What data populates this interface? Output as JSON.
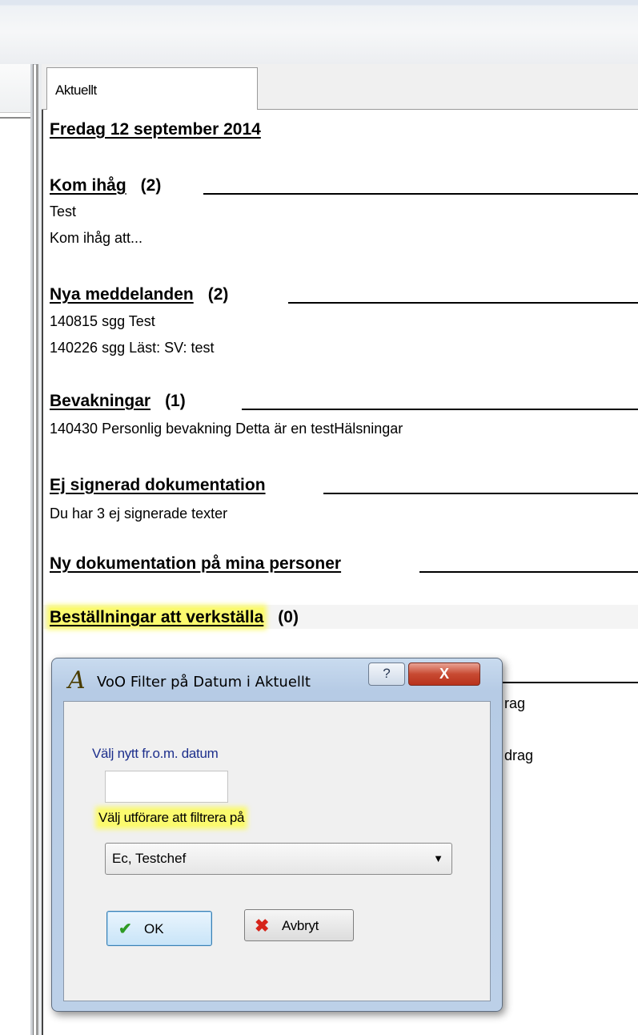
{
  "tab": {
    "label": "Aktuellt"
  },
  "content": {
    "date": "Fredag 12 september 2014",
    "sections": [
      {
        "title": "Kom ihåg",
        "count": "(2)",
        "lines": [
          "Test",
          "Kom ihåg att..."
        ]
      },
      {
        "title": "Nya meddelanden",
        "count": "(2)",
        "lines": [
          "140815  sgg  Test",
          "140226  sgg  Läst: SV: test"
        ]
      },
      {
        "title": "Bevakningar",
        "count": "(1)",
        "lines": [
          "140430  Personlig bevakning  Detta är en testHälsningar"
        ]
      },
      {
        "title": "Ej signerad dokumentation",
        "count": "",
        "lines": [
          "Du har 3 ej signerade texter"
        ]
      },
      {
        "title": "Ny dokumentation på mina personer",
        "count": "",
        "lines": []
      },
      {
        "title": "Beställningar att verkställa",
        "count": "(0)",
        "lines": []
      }
    ],
    "partial_lines": [
      "rag",
      "drag"
    ]
  },
  "dialog": {
    "title": "VoO Filter på Datum i Aktuellt",
    "help_label": "?",
    "close_label": "X",
    "date_label": "Välj nytt fr.o.m. datum",
    "date_value": "",
    "performer_label": "Välj utförare att filtrera på",
    "performer_value": "Ec, Testchef",
    "ok_label": "OK",
    "cancel_label": "Avbryt"
  },
  "icons": {
    "app": "app-logo-icon",
    "ok": "checkmark-icon",
    "cancel": "red-x-icon",
    "dropdown": "chevron-down-icon"
  },
  "colors": {
    "highlight": "#fbfa6e",
    "label_blue": "#1d2f8c",
    "close_red": "#c84a32"
  }
}
